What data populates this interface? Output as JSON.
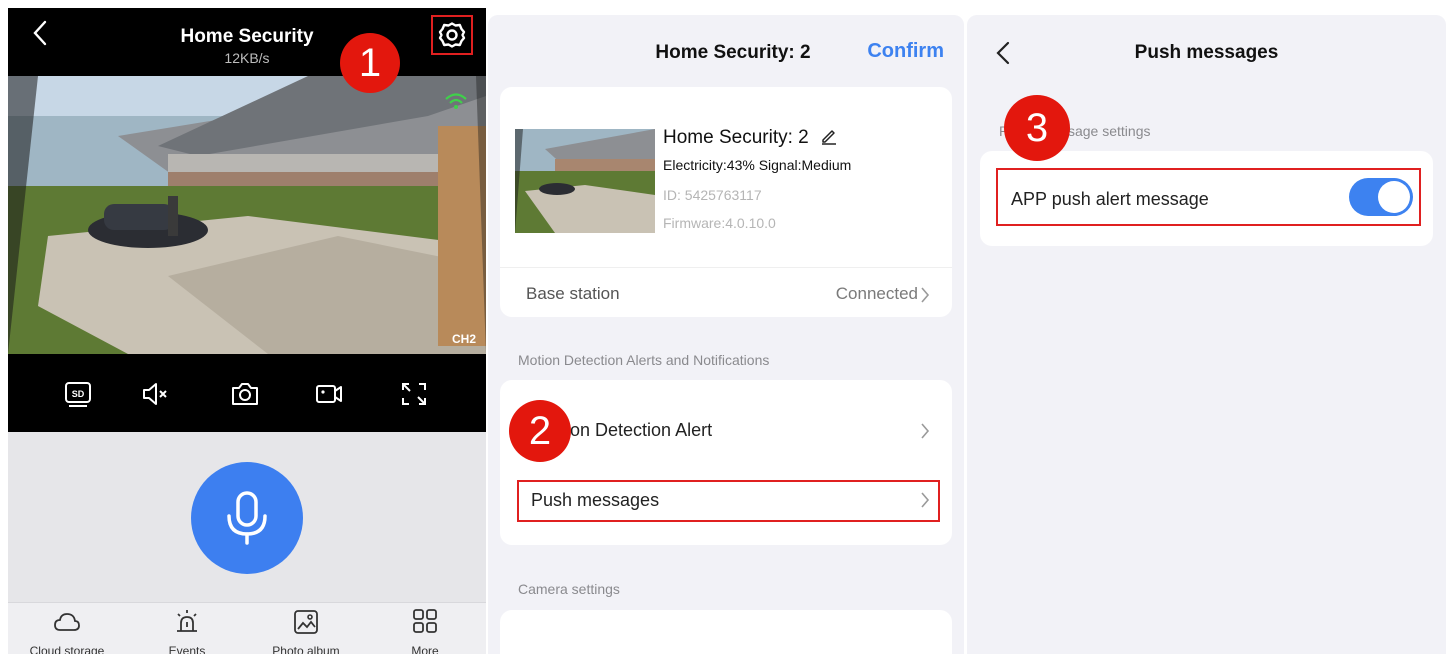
{
  "colors": {
    "accent": "#3d82f0",
    "highlight": "#e02020",
    "badge": "#e3170d"
  },
  "step_badges": [
    "1",
    "2",
    "3"
  ],
  "live_view": {
    "title": "Home Security",
    "speed": "12KB/s",
    "channel": "CH2",
    "controls": [
      "sd-card-icon",
      "mute-icon",
      "snapshot-icon",
      "record-icon",
      "fullscreen-icon"
    ],
    "bottom_nav": [
      {
        "label": "Cloud storage",
        "icon": "cloud-icon"
      },
      {
        "label": "Events",
        "icon": "siren-icon"
      },
      {
        "label": "Photo album",
        "icon": "image-icon"
      },
      {
        "label": "More",
        "icon": "grid-icon"
      }
    ]
  },
  "device_settings": {
    "title": "Home Security: 2",
    "confirm": "Confirm",
    "device_name": "Home Security: 2",
    "status": "Electricity:43% Signal:Medium",
    "device_id": "ID: 5425763117",
    "firmware": "Firmware:4.0.10.0",
    "base_station_label": "Base station",
    "base_station_value": "Connected",
    "alerts_section": "Motion Detection Alerts and Notifications",
    "motion_alert_partial": "on Detection Alert",
    "push_messages": "Push messages",
    "camera_section": "Camera settings"
  },
  "push_page": {
    "title": "Push messages",
    "section_left": "P",
    "section_right": "sage settings",
    "app_push_label": "APP push alert message",
    "app_push_enabled": true
  }
}
